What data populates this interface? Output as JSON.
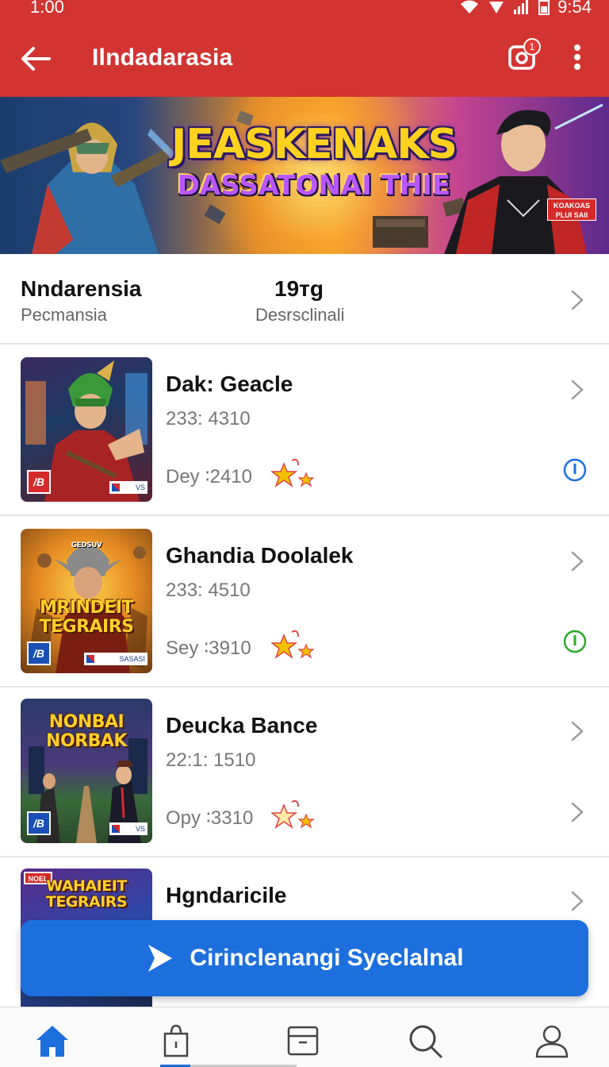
{
  "status_bar": {
    "time_left": "1:00",
    "time_right": "9:54"
  },
  "app_bar": {
    "title": "Ilndadarasia",
    "notification_count": "1"
  },
  "banner": {
    "title": "JEASKENAKS",
    "subtitle": "DASSATONAI THIE",
    "tag": "KOAKOAS PLUI SAII"
  },
  "info_row": {
    "name": "Nndarensia",
    "sub": "Pecmansia",
    "count": "19тg",
    "desc": "Desrsclinali"
  },
  "games": [
    {
      "title": "Dak: Geacle",
      "meta": "233: 4310",
      "date": "Dey ∶2410",
      "status": "info-outline"
    },
    {
      "title": "Ghandia Doolalek",
      "meta": "233: 4510",
      "date": "Sey ∶3910",
      "status": "info-outline-green",
      "thumb_text": "MRINDEIT TEGRAIRS",
      "thumb_small": "GEDSUV",
      "thumb_flag": "SASASI"
    },
    {
      "title": "Deucka Bance",
      "meta": "22:1: 1510",
      "date": "Opy ∶3310",
      "status": "chevron",
      "thumb_text": "NONBAI NORBAK"
    },
    {
      "title": "Hgndaricile",
      "thumb_text": "WAHAIEIT TEGRAIRS",
      "thumb_tag": "NOEL"
    }
  ],
  "cta": {
    "label": "Cirinclenangi  Syeclalnal"
  },
  "colors": {
    "primary": "#d23431",
    "accent": "#1d6fde",
    "star": "#f2c200"
  }
}
